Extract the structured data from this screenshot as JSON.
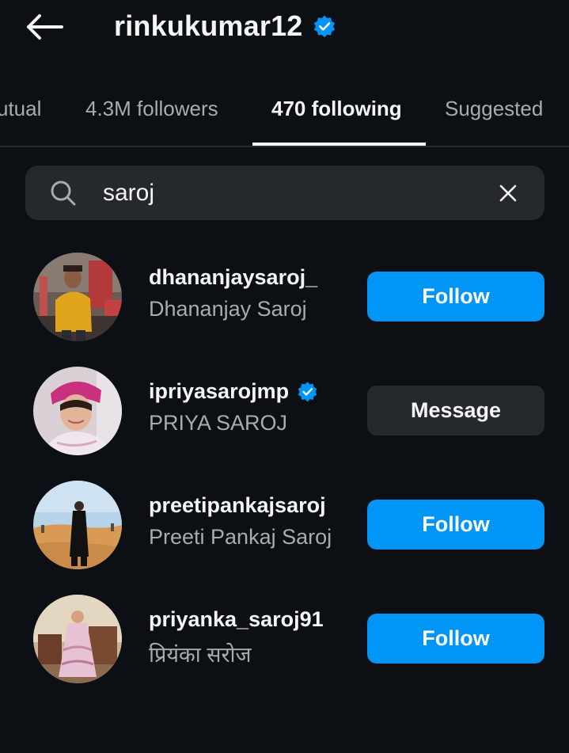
{
  "header": {
    "username": "rinkukumar12",
    "verified": true,
    "back_icon": "arrow-left-icon"
  },
  "tabs": [
    {
      "label": "utual",
      "active": false
    },
    {
      "label": "4.3M followers",
      "active": false
    },
    {
      "label": "470 following",
      "active": true
    },
    {
      "label": "Suggested",
      "active": false
    }
  ],
  "search": {
    "value": "saroj",
    "icon": "search-icon",
    "clear_icon": "close-icon"
  },
  "accounts": [
    {
      "username": "dhananjaysaroj_",
      "full_name": "Dhananjay Saroj",
      "verified": false,
      "action": "Follow",
      "action_type": "follow"
    },
    {
      "username": "ipriyasarojmp",
      "full_name": "PRIYA SAROJ",
      "verified": true,
      "action": "Message",
      "action_type": "message"
    },
    {
      "username": "preetipankajsaroj",
      "full_name": "Preeti Pankaj Saroj",
      "verified": false,
      "action": "Follow",
      "action_type": "follow"
    },
    {
      "username": "priyanka_saroj91",
      "full_name": "प्रियंका सरोज",
      "verified": false,
      "action": "Follow",
      "action_type": "follow"
    }
  ],
  "colors": {
    "background": "#0c1014",
    "accent": "#0095f6",
    "verified": "#0095f6",
    "secondary_button": "#25292e",
    "muted_text": "#a8abaf"
  }
}
